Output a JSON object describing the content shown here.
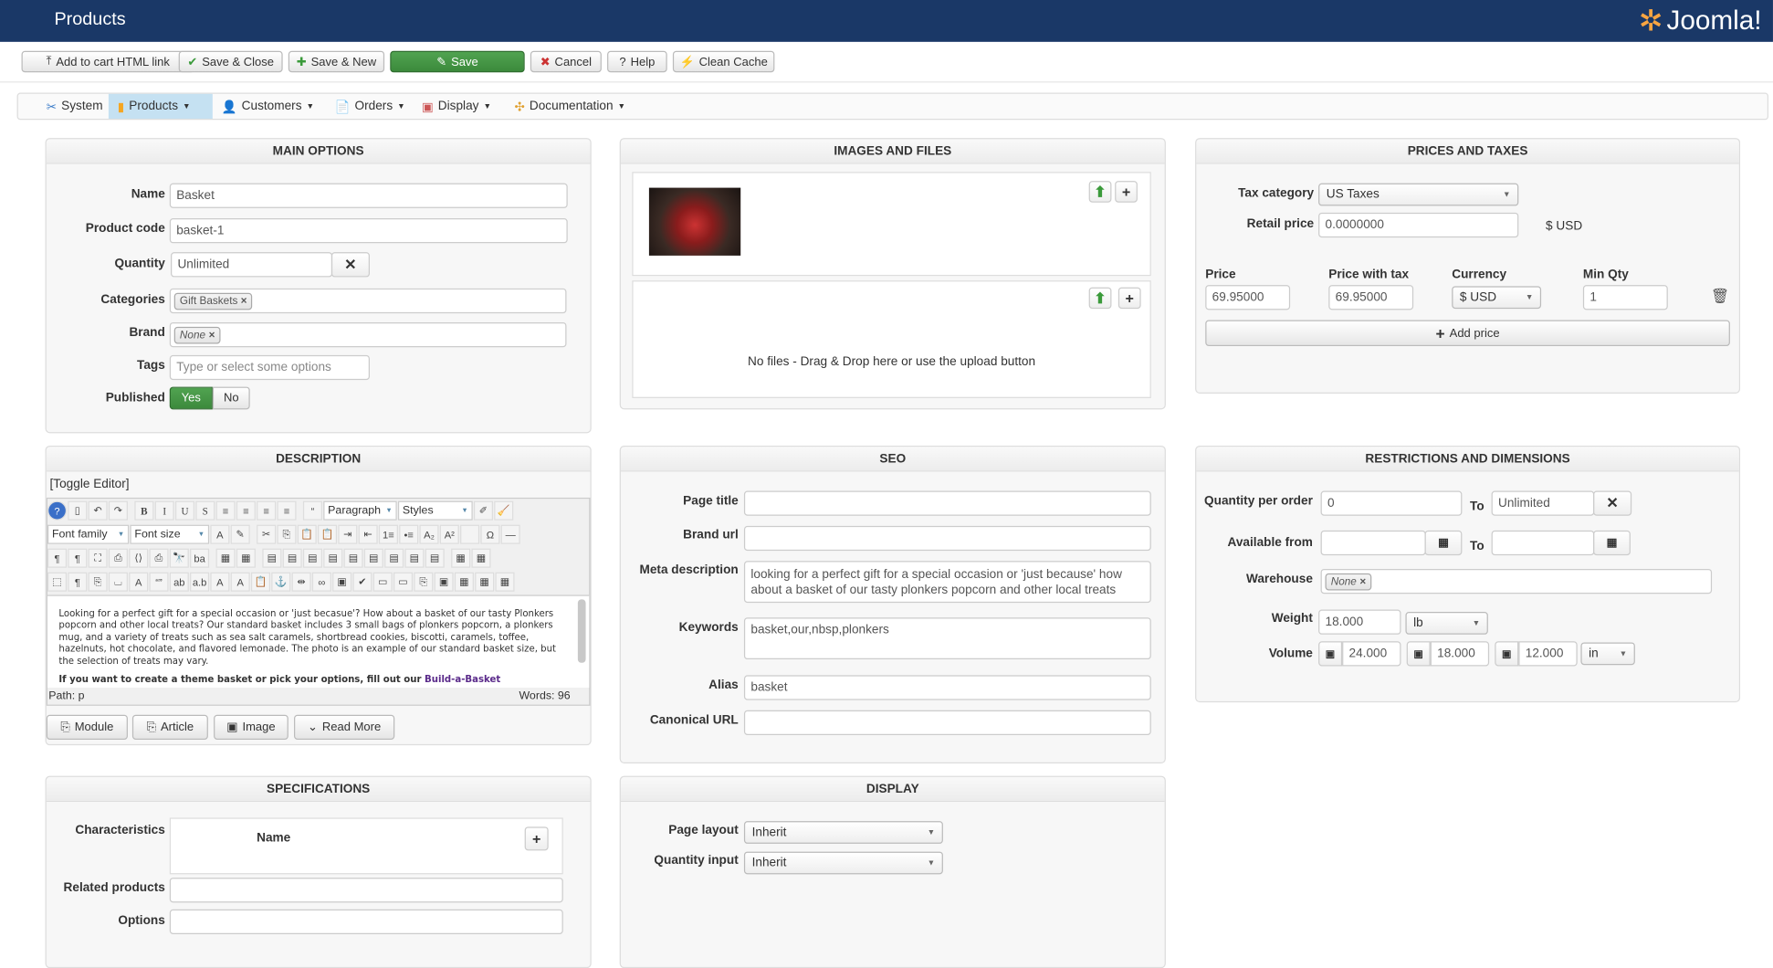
{
  "header": {
    "title": "Products",
    "logo_text": "Joomla!"
  },
  "toolbar": [
    {
      "label": "Add to cart HTML link",
      "icon": "upload-icon"
    },
    {
      "label": "Save & Close",
      "icon": "check-icon"
    },
    {
      "label": "Save & New",
      "icon": "plus-icon"
    },
    {
      "label": "Save",
      "icon": "edit-icon"
    },
    {
      "label": "Cancel",
      "icon": "cancel-icon"
    },
    {
      "label": "Help",
      "icon": "help-icon"
    },
    {
      "label": "Clean Cache",
      "icon": "flash-icon"
    }
  ],
  "menu": [
    {
      "label": "System"
    },
    {
      "label": "Products"
    },
    {
      "label": "Customers"
    },
    {
      "label": "Orders"
    },
    {
      "label": "Display"
    },
    {
      "label": "Documentation"
    }
  ],
  "main_options": {
    "title": "MAIN OPTIONS",
    "name_label": "Name",
    "name": "Basket",
    "code_label": "Product code",
    "code": "basket-1",
    "qty_label": "Quantity",
    "qty": "Unlimited",
    "cat_label": "Categories",
    "category": "Gift Baskets",
    "brand_label": "Brand",
    "brand": "None",
    "tags_label": "Tags",
    "tags_placeholder": "Type or select some options",
    "published_label": "Published",
    "yes": "Yes",
    "no": "No"
  },
  "images": {
    "title": "IMAGES AND FILES",
    "no_files": "No files - Drag & Drop here or use the upload button"
  },
  "prices": {
    "title": "PRICES AND TAXES",
    "tax_label": "Tax category",
    "tax": "US Taxes",
    "retail_label": "Retail price",
    "retail": "0.0000000",
    "retail_currency": "$ USD",
    "h_price": "Price",
    "h_pwt": "Price with tax",
    "h_currency": "Currency",
    "h_minqty": "Min Qty",
    "price": "69.95000",
    "pwt": "69.95000",
    "currency": "$ USD",
    "minqty": "1",
    "add_price": "Add price"
  },
  "description": {
    "title": "DESCRIPTION",
    "toggle": "[Toggle Editor]",
    "paragraph": "Paragraph",
    "styles": "Styles",
    "font_family": "Font family",
    "font_size": "Font size",
    "text": "Looking for a perfect gift for a special occasion or 'just becasue'? How about a basket of our tasty Plonkers popcorn and other local treats? Our standard basket includes 3 small bags of plonkers popcorn, a plonkers mug, and a variety of treats such as sea salt caramels, shortbread cookies, biscotti, caramels, toffee, hazelnuts, hot chocolate, and flavored lemonade. The photo is an example of our standard basket size, but the selection of treats may vary.",
    "bold_text": "If you want to create a theme basket or pick your options, fill out our ",
    "link_text": "Build-a-Basket",
    "path": "Path: p",
    "words": "Words: 96",
    "buttons": [
      "Module",
      "Article",
      "Image",
      "Read More"
    ]
  },
  "seo": {
    "title": "SEO",
    "page_title_label": "Page title",
    "brand_url_label": "Brand url",
    "meta_label": "Meta description",
    "meta": "looking for a perfect gift for a special occasion or 'just because' how about a basket of our tasty plonkers popcorn and other local treats",
    "keywords_label": "Keywords",
    "keywords": "basket,our,nbsp,plonkers",
    "alias_label": "Alias",
    "alias": "basket",
    "canonical_label": "Canonical URL"
  },
  "restrictions": {
    "title": "RESTRICTIONS AND DIMENSIONS",
    "qpo_label": "Quantity per order",
    "qpo_from": "0",
    "to": "To",
    "qpo_to": "Unlimited",
    "avail_label": "Available from",
    "warehouse_label": "Warehouse",
    "warehouse": "None",
    "weight_label": "Weight",
    "weight": "18.000",
    "weight_unit": "lb",
    "volume_label": "Volume",
    "v1": "24.000",
    "v2": "18.000",
    "v3": "12.000",
    "volume_unit": "in"
  },
  "specs": {
    "title": "SPECIFICATIONS",
    "char_label": "Characteristics",
    "name_col": "Name",
    "related_label": "Related products",
    "options_label": "Options"
  },
  "display": {
    "title": "DISPLAY",
    "layout_label": "Page layout",
    "layout": "Inherit",
    "qty_input_label": "Quantity input",
    "qty_input": "Inherit"
  },
  "editor_rows": [
    [
      "help",
      "new",
      "undo",
      "redo",
      "|",
      "B",
      "I",
      "U",
      "S",
      "≡",
      "≡",
      "≡",
      "≡",
      "|",
      "“"
    ],
    [
      "A",
      "✎",
      "|",
      "✂",
      "⎘",
      "📋",
      "📋",
      "⇥",
      "⇤",
      "1≡",
      "•≡",
      "A₂",
      "A²",
      "",
      "Ω",
      "—"
    ],
    [
      "¶",
      "¶",
      "⛶",
      "⎙",
      "⟨⟩",
      "⎙",
      "🔭",
      "ba",
      "|",
      "▦",
      "▦",
      "|",
      "▤",
      "▤",
      "▤",
      "▤",
      "▤",
      "▤",
      "▤",
      "▤",
      "▤",
      "|",
      "▦",
      "▦"
    ],
    [
      "⬚",
      "¶",
      "⎘",
      "⌴",
      "A",
      "“”",
      "ab",
      "a.b",
      "A",
      "A",
      "📋",
      "⚓",
      "⇹",
      "∞",
      "▣",
      "✔",
      "▭",
      "▭",
      "⎘",
      "▣",
      "▦",
      "▦",
      "▦"
    ]
  ]
}
